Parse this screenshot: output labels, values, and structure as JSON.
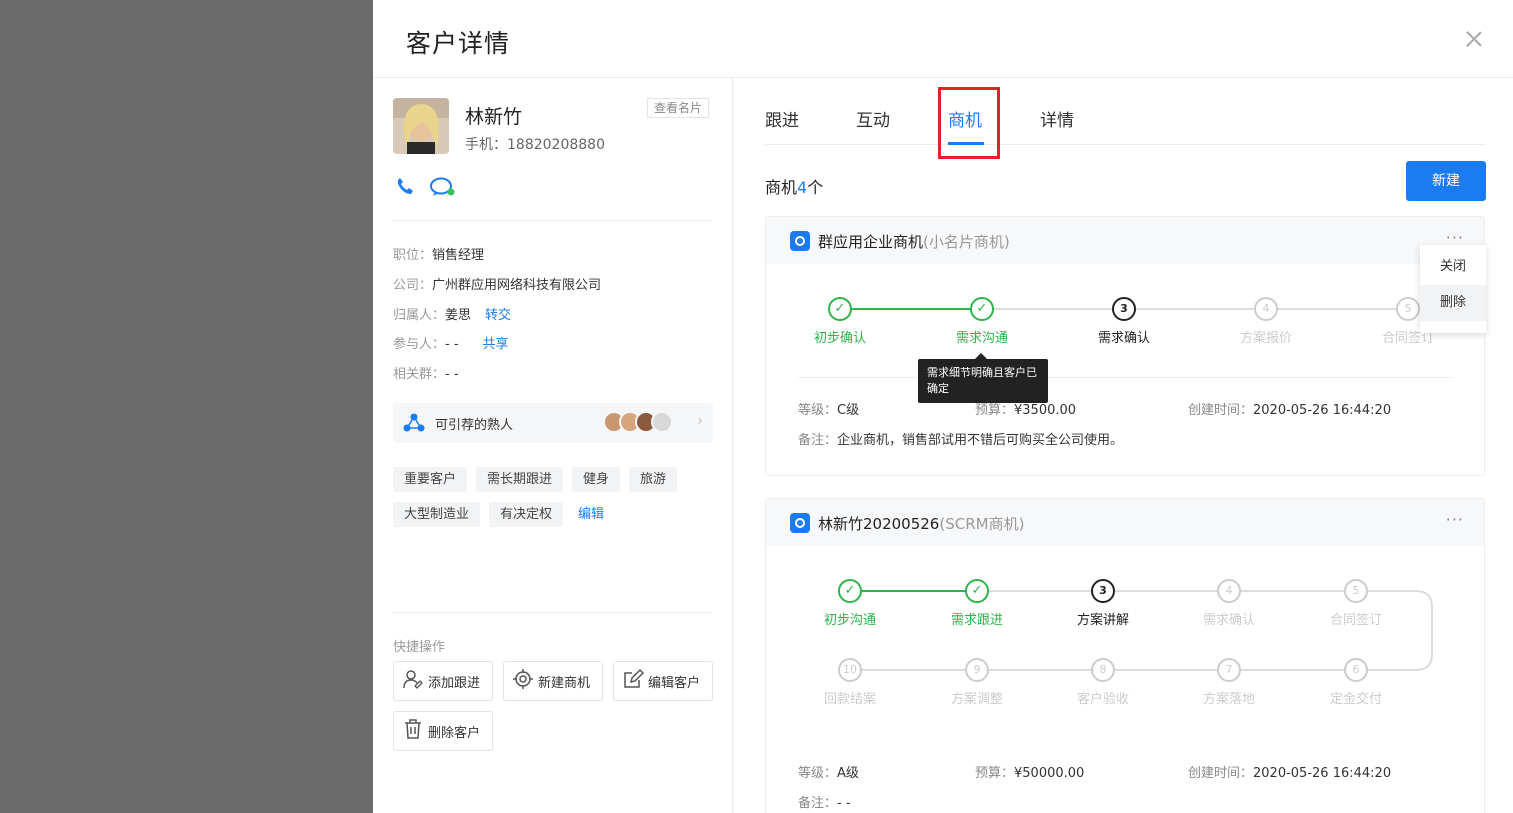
{
  "drawer": {
    "title": "客户详情"
  },
  "customer": {
    "name": "林新竹",
    "phone": "手机：18820208880",
    "view_card": "查看名片",
    "fields": [
      {
        "key": "职位：",
        "value": "销售经理",
        "link": ""
      },
      {
        "key": "公司：",
        "value": "广州群应用网络科技有限公司",
        "link": ""
      },
      {
        "key": "归属人：",
        "value": "姜思",
        "link": "转交"
      },
      {
        "key": "参与人：",
        "value": "- -",
        "link": "共享"
      },
      {
        "key": "相关群：",
        "value": "- -",
        "link": ""
      }
    ],
    "referral_label": "可引荐的熟人",
    "tags": [
      "重要客户",
      "需长期跟进",
      "健身",
      "旅游",
      "大型制造业",
      "有决定权"
    ],
    "tag_edit": "编辑",
    "quick_title": "快捷操作",
    "quick_actions": [
      "添加跟进",
      "新建商机",
      "编辑客户",
      "删除客户"
    ]
  },
  "tabs": [
    "跟进",
    "互动",
    "商机",
    "详情"
  ],
  "opportunities": {
    "count_label": "商机",
    "count": "4",
    "count_suffix": "个",
    "new_label": "新建",
    "more": "···",
    "items": [
      {
        "title": "群应用企业商机",
        "subtitle": "(小名片商机)",
        "steps": [
          {
            "label": "初步确认",
            "mark": "✓",
            "state": "done"
          },
          {
            "label": "需求沟通",
            "mark": "✓",
            "state": "done"
          },
          {
            "label": "需求确认",
            "mark": "3",
            "state": "cur"
          },
          {
            "label": "方案报价",
            "mark": "4",
            "state": "todo"
          },
          {
            "label": "合同签订",
            "mark": "5",
            "state": "todo"
          }
        ],
        "level_key": "等级：",
        "level": "C级",
        "budget_key": "预算：",
        "budget": "¥3500.00",
        "created_key": "创建时间：",
        "created": "2020-05-26 16:44:20",
        "note_key": "备注：",
        "note": "企业商机，销售部试用不错后可购买全公司使用。"
      },
      {
        "title": "林新竹20200526",
        "subtitle": "(SCRM商机)",
        "steps": [
          {
            "label": "初步沟通",
            "mark": "✓",
            "state": "done"
          },
          {
            "label": "需求跟进",
            "mark": "✓",
            "state": "done"
          },
          {
            "label": "方案讲解",
            "mark": "3",
            "state": "cur"
          },
          {
            "label": "需求确认",
            "mark": "4",
            "state": "todo"
          },
          {
            "label": "合同签订",
            "mark": "5",
            "state": "todo"
          },
          {
            "label": "定金交付",
            "mark": "6",
            "state": "todo"
          },
          {
            "label": "方案落地",
            "mark": "7",
            "state": "todo"
          },
          {
            "label": "客户验收",
            "mark": "8",
            "state": "todo"
          },
          {
            "label": "方案调整",
            "mark": "9",
            "state": "todo"
          },
          {
            "label": "回款结案",
            "mark": "10",
            "state": "todo"
          }
        ],
        "level_key": "等级：",
        "level": "A级",
        "budget_key": "预算：",
        "budget": "¥50000.00",
        "created_key": "创建时间：",
        "created": "2020-05-26 16:44:20",
        "note_key": "备注：",
        "note": "- -"
      }
    ]
  },
  "tooltip": "需求细节明确且客户已确定",
  "dropdown": [
    "关闭",
    "删除"
  ],
  "colors": {
    "accent": "#1a7cf0",
    "done": "#2db44b",
    "highlight": "#e8202a"
  }
}
